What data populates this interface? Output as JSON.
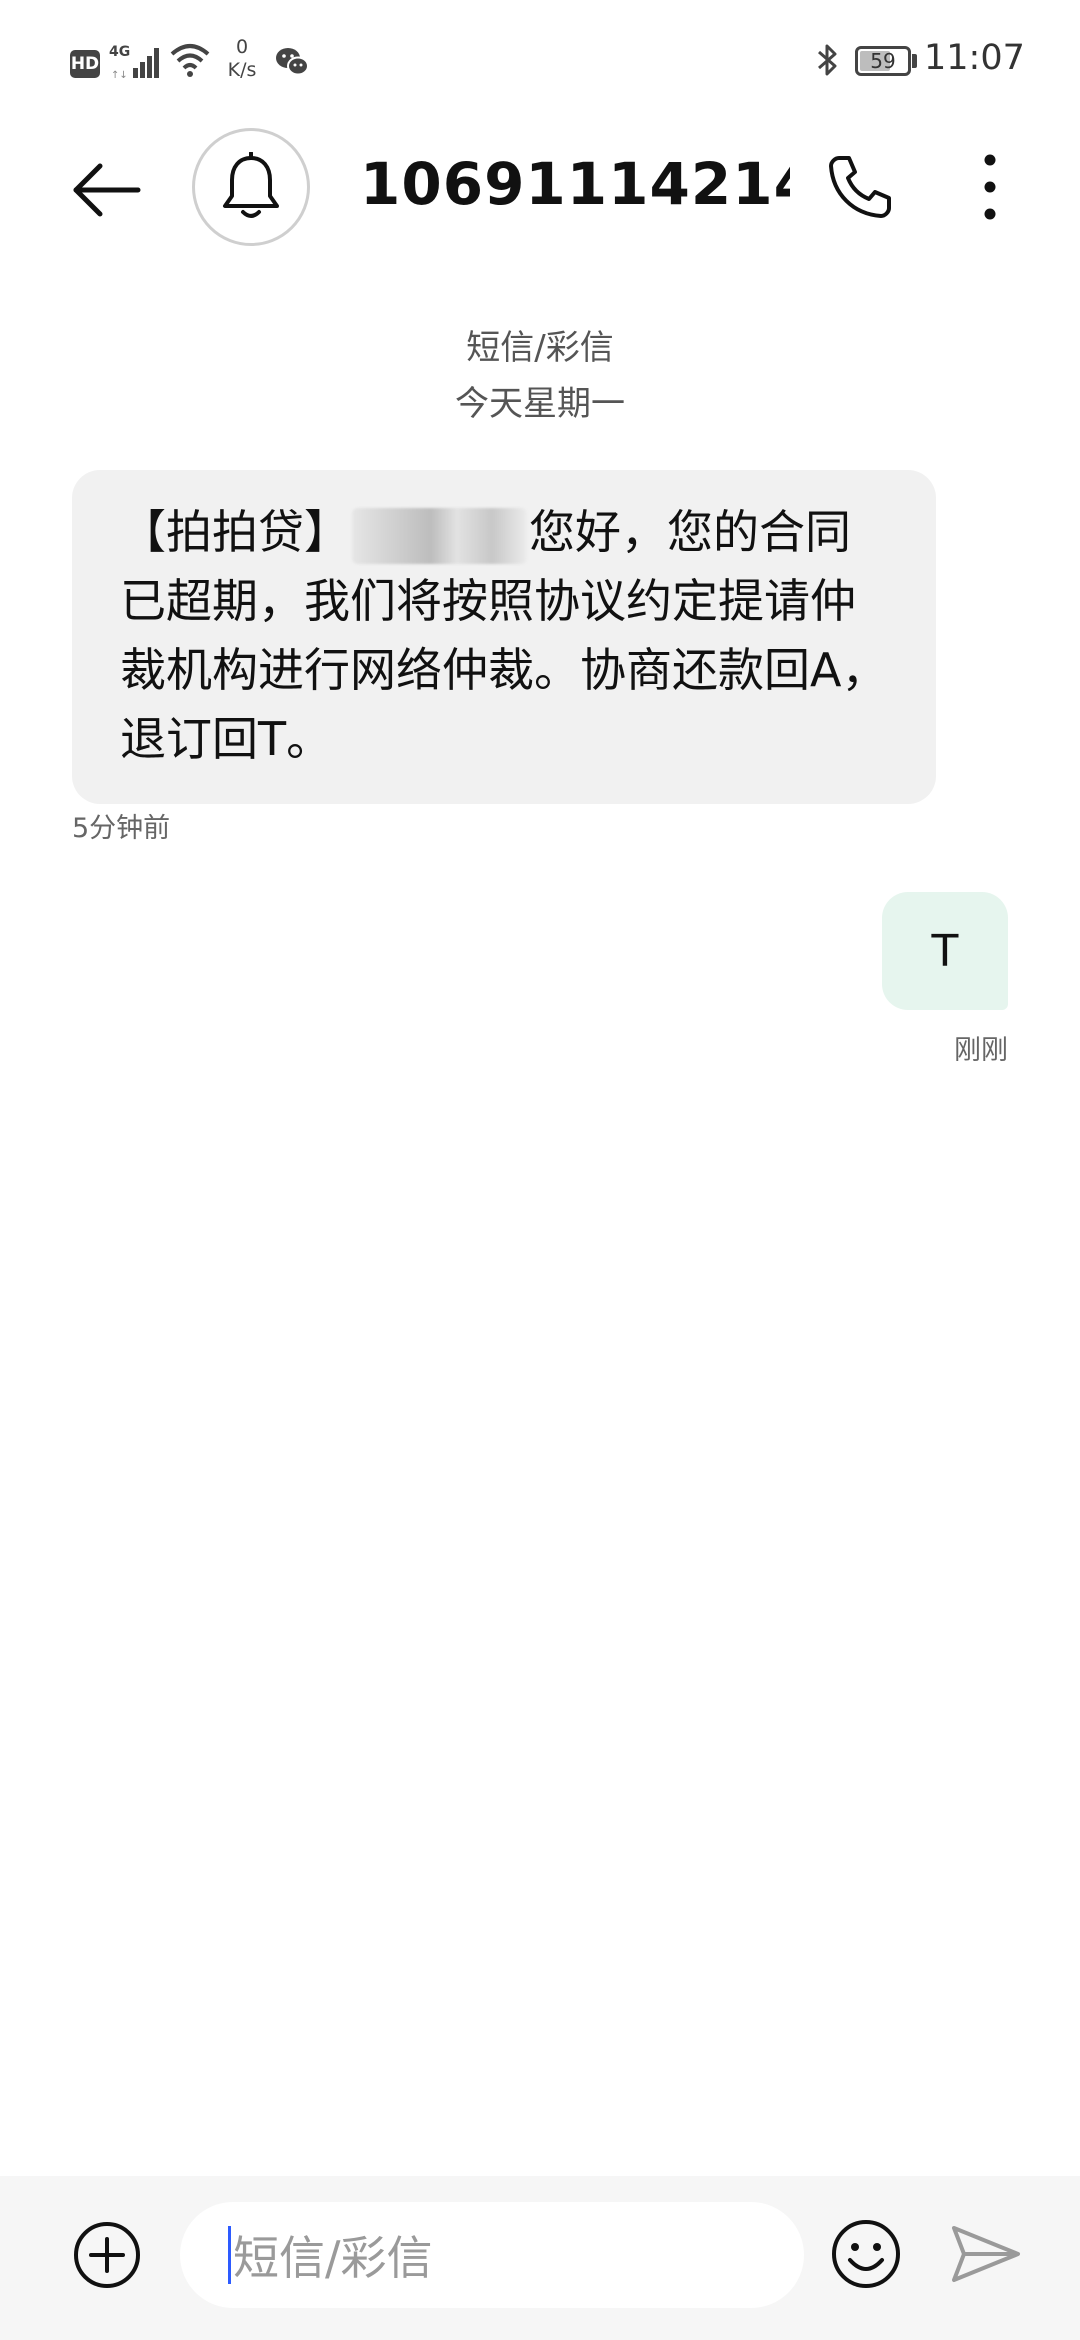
{
  "status_bar": {
    "hd": "HD",
    "network": "4G",
    "speed_value": "0",
    "speed_unit": "K/s",
    "battery": "59",
    "battery_level_percent": 59,
    "time": "11:07"
  },
  "header": {
    "title": "10691114214...",
    "back_icon": "back-arrow-icon",
    "avatar_icon": "bell-icon",
    "call_icon": "phone-icon",
    "more_icon": "more-vertical-icon"
  },
  "conversation": {
    "type": "短信/彩信",
    "date": "今天星期一"
  },
  "messages": [
    {
      "direction": "incoming",
      "text_before": "【拍拍贷】",
      "text_after": "您好，您的合同已超期，我们将按照协议约定提请仲裁机构进行网络仲裁。协商还款回A，退订回T。",
      "time": "5分钟前"
    },
    {
      "direction": "outgoing",
      "text": "T",
      "time": "刚刚"
    }
  ],
  "compose": {
    "placeholder": "短信/彩信",
    "attach_icon": "plus-circle-icon",
    "emoji_icon": "emoji-icon",
    "send_icon": "send-icon"
  },
  "colors": {
    "incoming_bubble": "#f1f1f1",
    "outgoing_bubble": "#e6f5ee",
    "cursor": "#2d5bff",
    "compose_bar": "#f6f6f6"
  }
}
